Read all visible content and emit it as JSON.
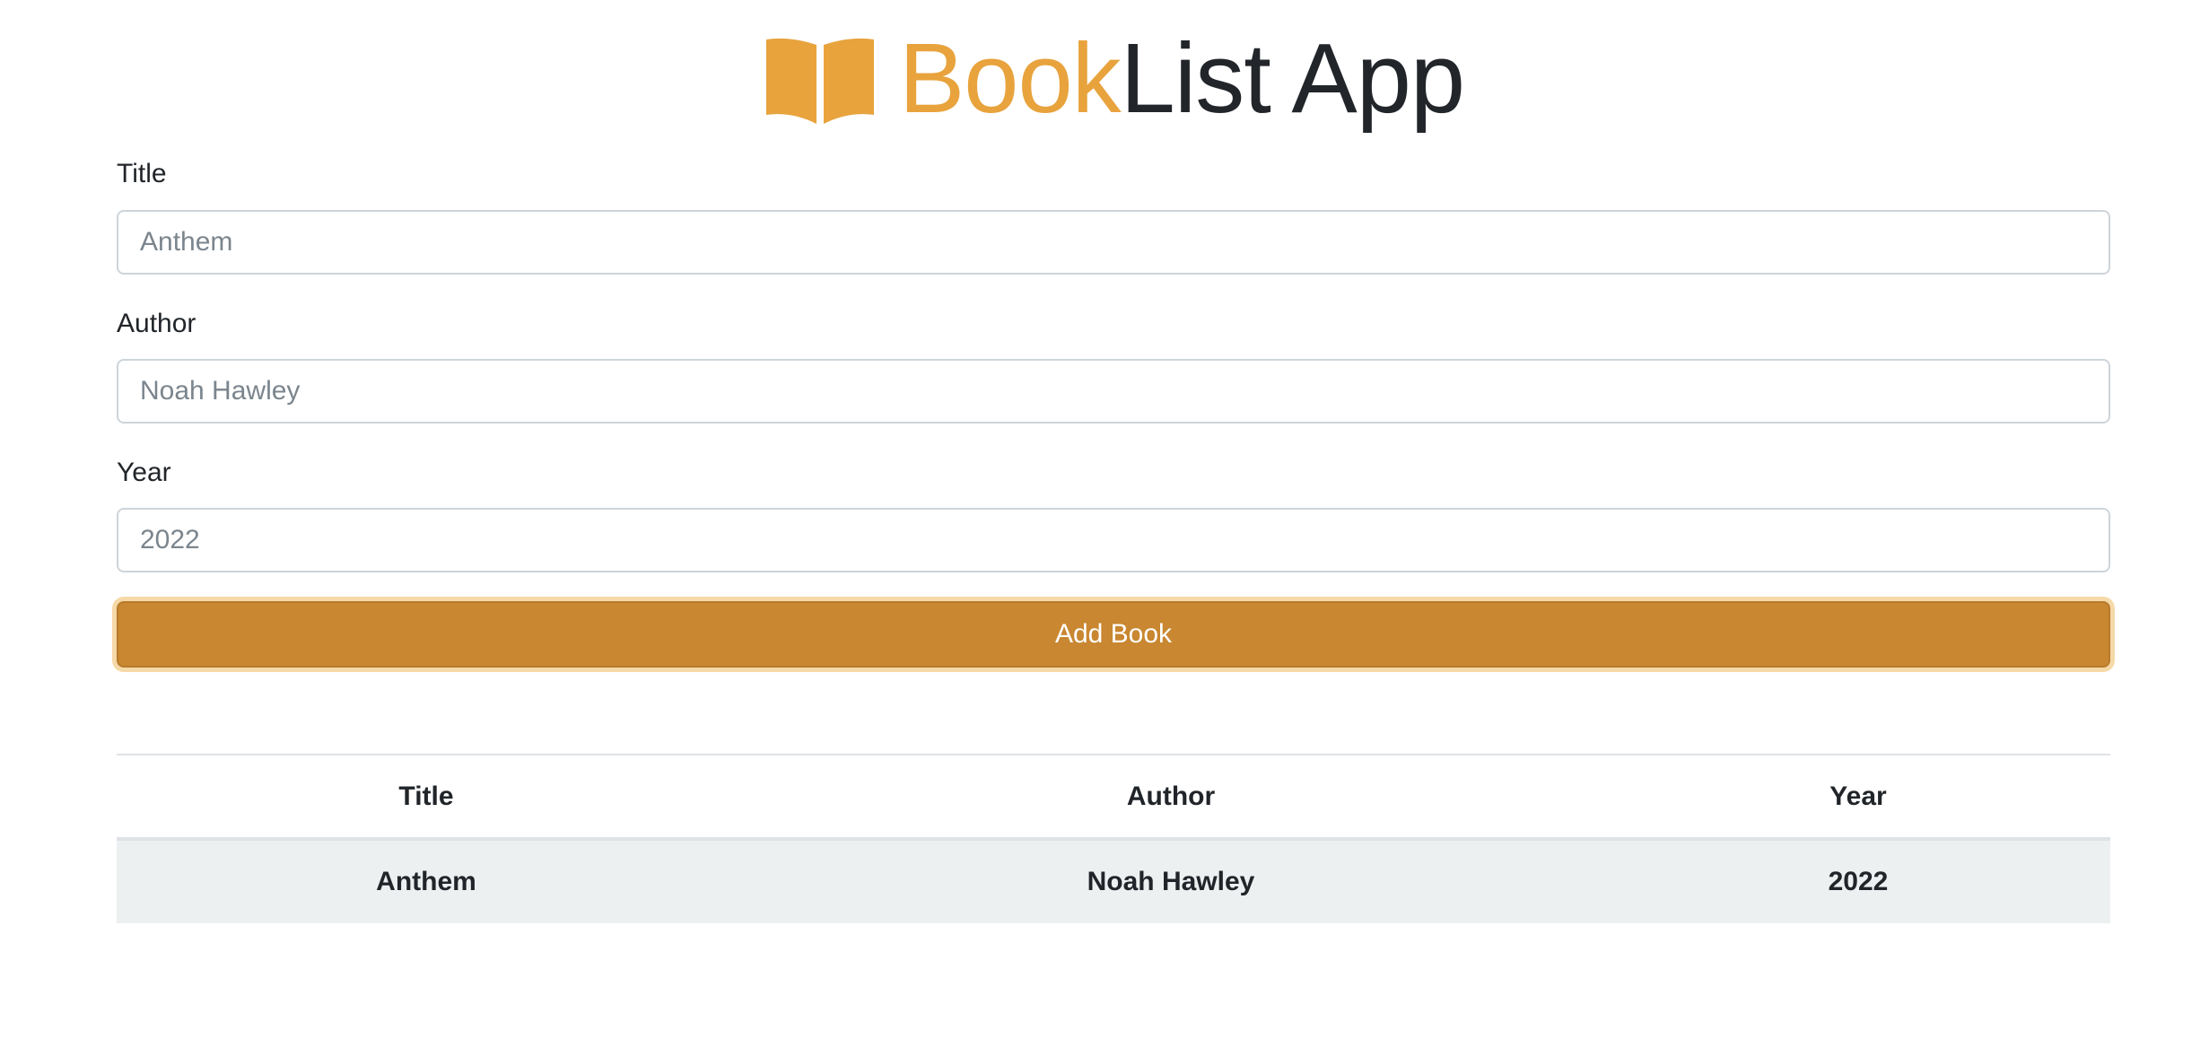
{
  "header": {
    "title_part1": "Book",
    "title_part2": "List App",
    "icon": "open-book-icon",
    "accent_color": "#e8a33d"
  },
  "form": {
    "title_label": "Title",
    "title_placeholder": "Anthem",
    "author_label": "Author",
    "author_placeholder": "Noah Hawley",
    "year_label": "Year",
    "year_placeholder": "2022",
    "submit_label": "Add Book",
    "submit_color": "#c98731"
  },
  "table": {
    "headers": [
      "Title",
      "Author",
      "Year"
    ],
    "rows": [
      [
        "Anthem",
        "Noah Hawley",
        "2022"
      ]
    ],
    "row_background": "#ecf0f1"
  }
}
